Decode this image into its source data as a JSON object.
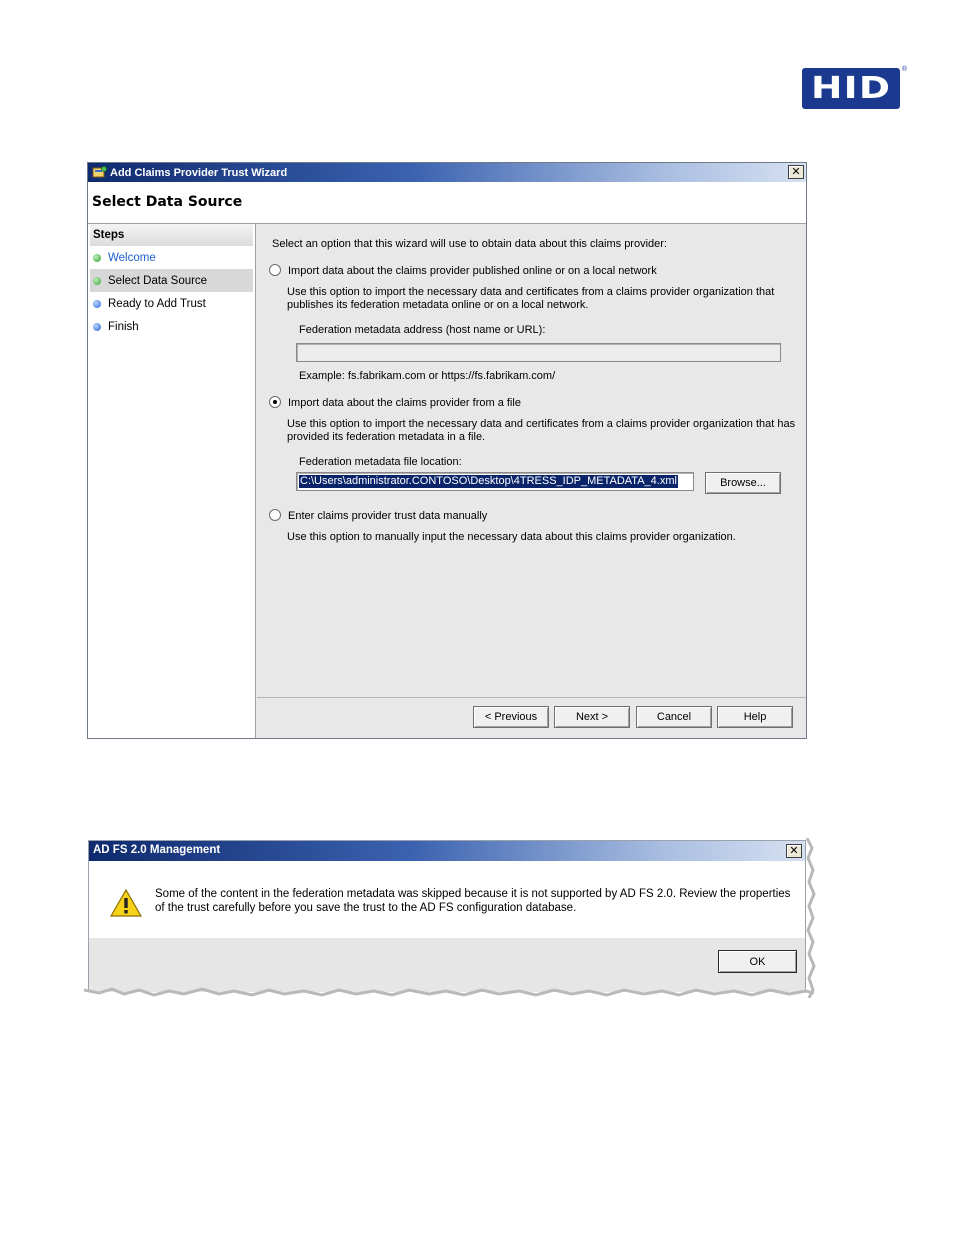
{
  "logo": {
    "text": "HID",
    "reg": "®"
  },
  "wizard": {
    "title": "Add Claims Provider Trust Wizard",
    "close": "✕",
    "header": "Select Data Source",
    "steps_title": "Steps",
    "steps": [
      {
        "label": "Welcome",
        "state": "done"
      },
      {
        "label": "Select Data Source",
        "state": "current"
      },
      {
        "label": "Ready to Add Trust",
        "state": "pending"
      },
      {
        "label": "Finish",
        "state": "pending"
      }
    ],
    "intro": "Select an option that this wizard will use to obtain data about this claims provider:",
    "option_online": {
      "label": "Import data about the claims provider published online or on a local network",
      "desc_line1": "Use this option to import the necessary data and certificates from a claims provider organization that",
      "desc_line2": "publishes its federation metadata online or on a local network.",
      "field_label": "Federation metadata address (host name or URL):",
      "field_value": "",
      "example": "Example: fs.fabrikam.com or https://fs.fabrikam.com/"
    },
    "option_file": {
      "label": "Import data about the claims provider from a file",
      "desc_line1": "Use this option to import the necessary data and certificates from a claims provider organization that has",
      "desc_line2": "provided its federation metadata in a file.",
      "field_label": "Federation metadata file location:",
      "field_value": "C:\\Users\\administrator.CONTOSO\\Desktop\\4TRESS_IDP_METADATA_4.xml",
      "browse": "Browse..."
    },
    "option_manual": {
      "label": "Enter claims provider trust data manually",
      "desc": "Use this option to manually input the necessary data about this claims provider organization."
    },
    "selected_option": "option_file",
    "buttons": {
      "previous": "< Previous",
      "next": "Next >",
      "cancel": "Cancel",
      "help": "Help"
    }
  },
  "message_box": {
    "title": "AD FS 2.0 Management",
    "close": "✕",
    "line1": "Some of the content in the federation metadata was skipped because it is not supported by AD FS 2.0. Review the properties",
    "line2": "of the trust carefully before you save the trust to the AD FS configuration database.",
    "ok": "OK"
  },
  "colors": {
    "titlebar_start": "#0f2a6e",
    "brand": "#1b3a8f",
    "link": "#1a5fd0"
  }
}
